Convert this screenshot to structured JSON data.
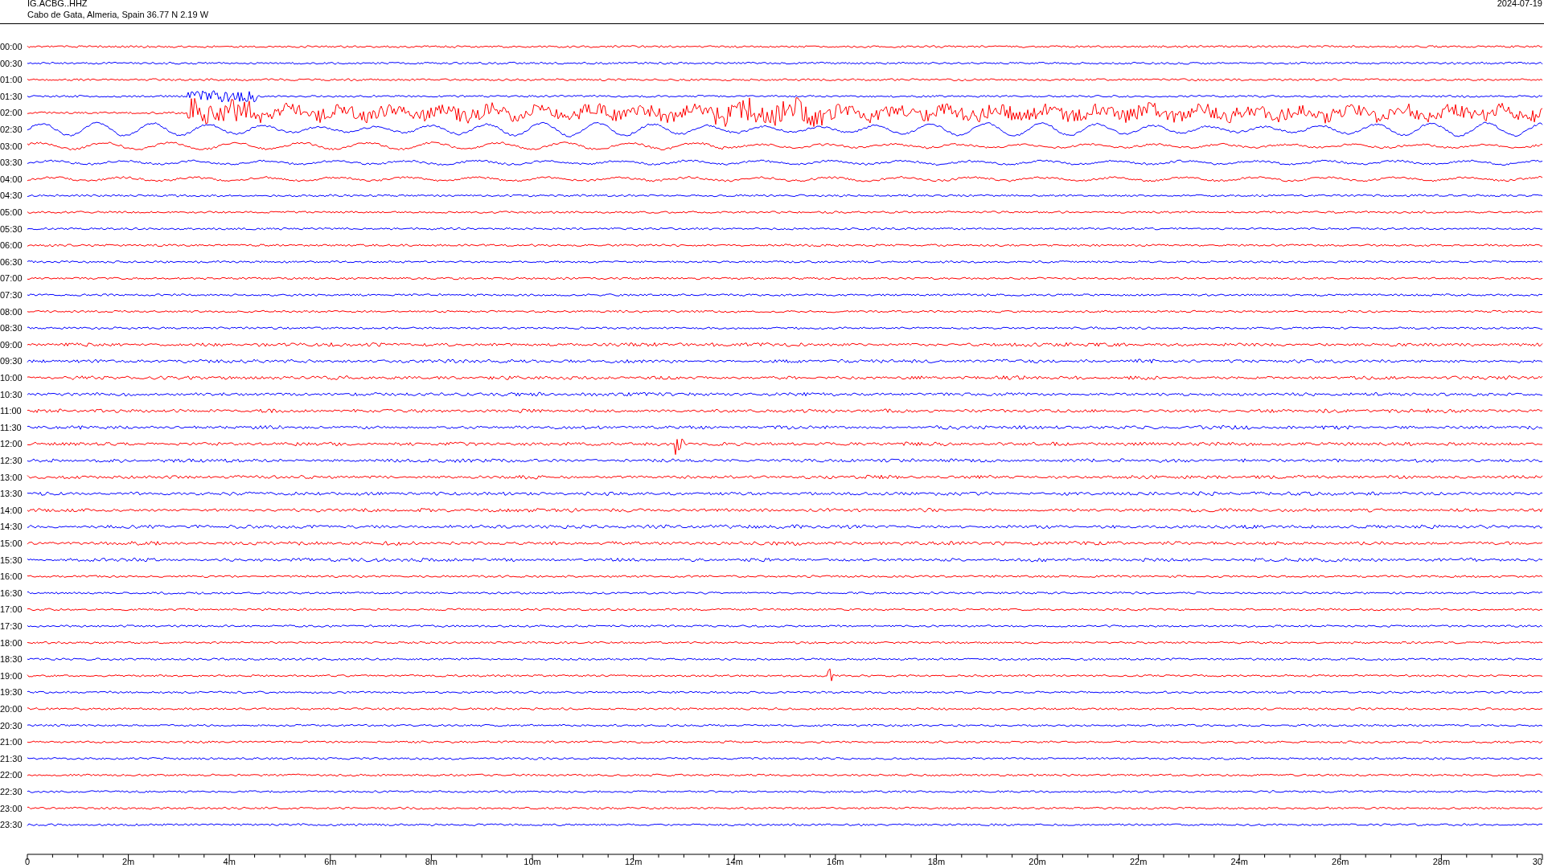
{
  "header": {
    "station": "IG.ACBG..HHZ",
    "location": "Cabo de Gata, Almeria, Spain  36.77 N 2.19 W",
    "date": "2024-07-19"
  },
  "rows": [
    {
      "label": "00:00",
      "color": "#ff0000"
    },
    {
      "label": "00:30",
      "color": "#0000ff"
    },
    {
      "label": "01:00",
      "color": "#ff0000"
    },
    {
      "label": "01:30",
      "color": "#0000ff"
    },
    {
      "label": "02:00",
      "color": "#ff0000"
    },
    {
      "label": "02:30",
      "color": "#0000ff"
    },
    {
      "label": "03:00",
      "color": "#ff0000"
    },
    {
      "label": "03:30",
      "color": "#0000ff"
    },
    {
      "label": "04:00",
      "color": "#ff0000"
    },
    {
      "label": "04:30",
      "color": "#0000ff"
    },
    {
      "label": "05:00",
      "color": "#ff0000"
    },
    {
      "label": "05:30",
      "color": "#0000ff"
    },
    {
      "label": "06:00",
      "color": "#ff0000"
    },
    {
      "label": "06:30",
      "color": "#0000ff"
    },
    {
      "label": "07:00",
      "color": "#ff0000"
    },
    {
      "label": "07:30",
      "color": "#0000ff"
    },
    {
      "label": "08:00",
      "color": "#ff0000"
    },
    {
      "label": "08:30",
      "color": "#0000ff"
    },
    {
      "label": "09:00",
      "color": "#ff0000"
    },
    {
      "label": "09:30",
      "color": "#0000ff"
    },
    {
      "label": "10:00",
      "color": "#ff0000"
    },
    {
      "label": "10:30",
      "color": "#0000ff"
    },
    {
      "label": "11:00",
      "color": "#ff0000"
    },
    {
      "label": "11:30",
      "color": "#0000ff"
    },
    {
      "label": "12:00",
      "color": "#ff0000"
    },
    {
      "label": "12:30",
      "color": "#0000ff"
    },
    {
      "label": "13:00",
      "color": "#ff0000"
    },
    {
      "label": "13:30",
      "color": "#0000ff"
    },
    {
      "label": "14:00",
      "color": "#ff0000"
    },
    {
      "label": "14:30",
      "color": "#0000ff"
    },
    {
      "label": "15:00",
      "color": "#ff0000"
    },
    {
      "label": "15:30",
      "color": "#0000ff"
    },
    {
      "label": "16:00",
      "color": "#ff0000"
    },
    {
      "label": "16:30",
      "color": "#0000ff"
    },
    {
      "label": "17:00",
      "color": "#ff0000"
    },
    {
      "label": "17:30",
      "color": "#0000ff"
    },
    {
      "label": "18:00",
      "color": "#ff0000"
    },
    {
      "label": "18:30",
      "color": "#0000ff"
    },
    {
      "label": "19:00",
      "color": "#ff0000"
    },
    {
      "label": "19:30",
      "color": "#0000ff"
    },
    {
      "label": "20:00",
      "color": "#ff0000"
    },
    {
      "label": "20:30",
      "color": "#0000ff"
    },
    {
      "label": "21:00",
      "color": "#ff0000"
    },
    {
      "label": "21:30",
      "color": "#0000ff"
    },
    {
      "label": "22:00",
      "color": "#ff0000"
    },
    {
      "label": "22:30",
      "color": "#0000ff"
    },
    {
      "label": "23:00",
      "color": "#ff0000"
    },
    {
      "label": "23:30",
      "color": "#0000ff"
    }
  ],
  "axis": {
    "tick_labels": [
      "0",
      "2m",
      "4m",
      "6m",
      "8m",
      "10m",
      "12m",
      "14m",
      "16m",
      "18m",
      "20m",
      "22m",
      "24m",
      "26m",
      "28m",
      "30"
    ]
  }
}
